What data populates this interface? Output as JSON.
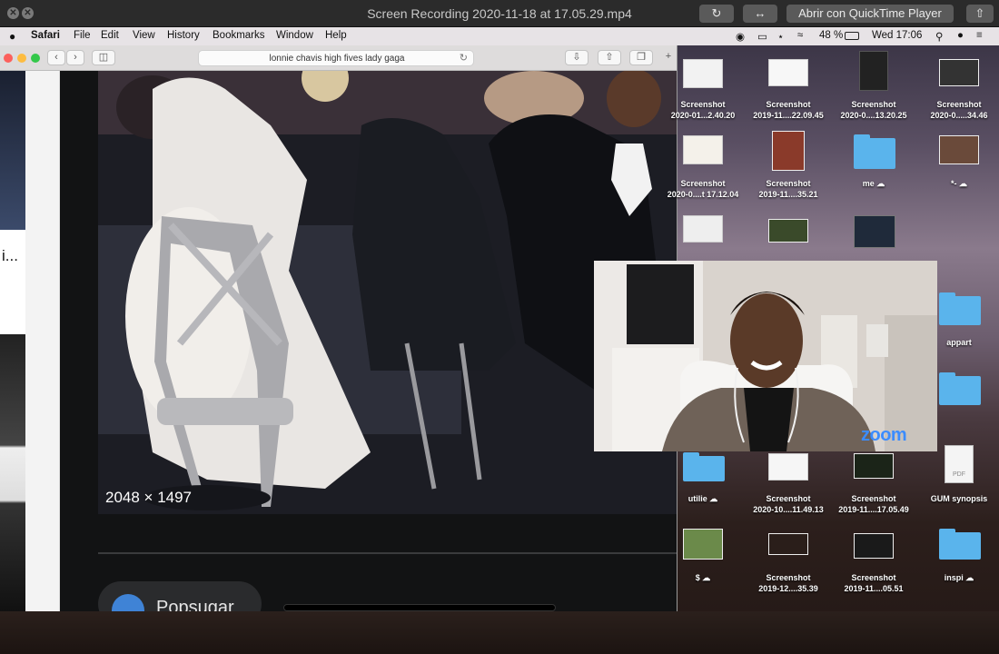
{
  "player": {
    "title": "Screen Recording 2020-11-18 at 17.05.29.mp4",
    "open_with_label": "Abrir con QuickTime Player",
    "close_glyph": "✕",
    "rotate_glyph": "↻",
    "trim_glyph": "↔",
    "share_glyph": "⇧"
  },
  "menubar": {
    "apple_glyph": "",
    "app_name": "Safari",
    "items": [
      "File",
      "Edit",
      "View",
      "History",
      "Bookmarks",
      "Window",
      "Help"
    ],
    "battery": "48 %",
    "clock": "Wed 17:06"
  },
  "safari": {
    "address": "lonnie chavis high fives lady gaga",
    "left_text_snippet": "i...",
    "image_dimensions": "2048 × 1497",
    "source_label": "Popsugar"
  },
  "desktop": {
    "icons": [
      {
        "label": "Screenshot",
        "sub": "2020-01...2.40.20"
      },
      {
        "label": "Screenshot",
        "sub": "2019-11....22.09.45"
      },
      {
        "label": "Screenshot",
        "sub": "2020-0....13.20.25"
      },
      {
        "label": "Screenshot",
        "sub": "2020-0.....34.46"
      },
      {
        "label": "Screenshot",
        "sub": "2020-0....t 17.12.04"
      },
      {
        "label": "Screenshot",
        "sub": "2019-11....35.21"
      },
      {
        "label": "me",
        "sub": ""
      },
      {
        "label": "*-",
        "sub": ""
      },
      {
        "label": "appart",
        "sub": ""
      },
      {
        "label": "utilie",
        "sub": ""
      },
      {
        "label": "Screenshot",
        "sub": "2020-10....11.49.13"
      },
      {
        "label": "Screenshot",
        "sub": "2019-11....17.05.49"
      },
      {
        "label": "GUM synopsis",
        "sub": ""
      },
      {
        "label": "$",
        "sub": ""
      },
      {
        "label": "Screenshot",
        "sub": "2019-12....35.39"
      },
      {
        "label": "Screenshot",
        "sub": "2019-11....05.51"
      },
      {
        "label": "inspi",
        "sub": ""
      }
    ],
    "cloud_glyph": "☁",
    "pdf_label": "PDF"
  },
  "zoom": {
    "brand": "zoom"
  },
  "colors": {
    "folder": "#5ab4ec",
    "zoom_blue": "#3b8cff",
    "safari_red": "#fc605c",
    "safari_yellow": "#fdbc40",
    "safari_green": "#34c84a"
  }
}
